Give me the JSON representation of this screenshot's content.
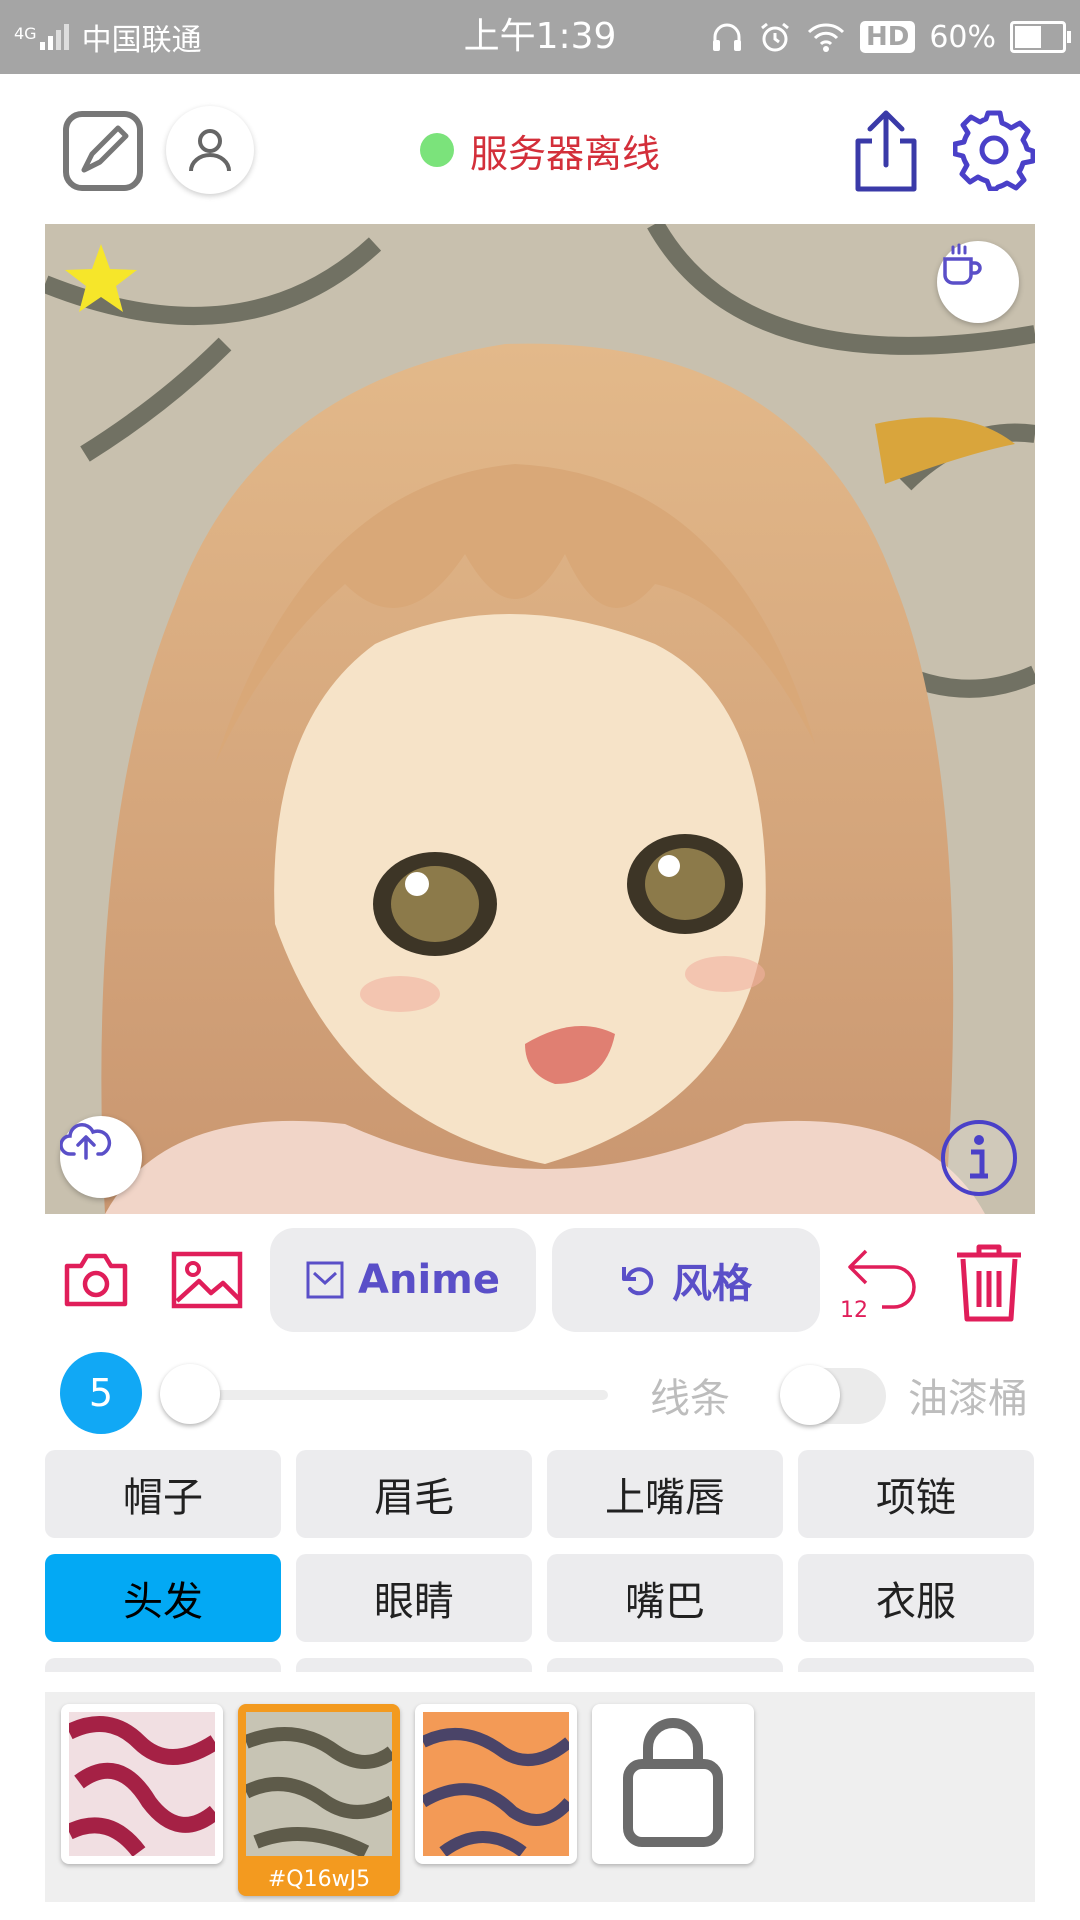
{
  "status_bar": {
    "network": "4G",
    "carrier": "中国联通",
    "time": "上午1:39",
    "hd": "HD",
    "battery": "60%",
    "battery_level": 0.6
  },
  "toolbar": {
    "left_icons": [
      "sketch-icon",
      "user-icon"
    ],
    "server_status": "服务器离线",
    "server_status_color": "#7be37b",
    "right_icons": [
      "share-icon",
      "settings-icon"
    ]
  },
  "canvas": {
    "overlay_icons": [
      "star-icon",
      "coffee-icon",
      "cloud-upload-icon",
      "info-icon"
    ]
  },
  "actions": {
    "camera": "camera-icon",
    "gallery": "image-icon",
    "anime_label": "Anime",
    "style_label": "风格",
    "undo_count": "12",
    "delete": "trash-icon"
  },
  "controls": {
    "brush_size": "5",
    "slider_value": 0,
    "line_label": "线条",
    "bucket_label": "油漆桶",
    "bucket_enabled": false
  },
  "categories": [
    {
      "label": "帽子",
      "selected": false
    },
    {
      "label": "眉毛",
      "selected": false
    },
    {
      "label": "上嘴唇",
      "selected": false
    },
    {
      "label": "项链",
      "selected": false
    },
    {
      "label": "头发",
      "selected": true
    },
    {
      "label": "眼睛",
      "selected": false
    },
    {
      "label": "嘴巴",
      "selected": false
    },
    {
      "label": "衣服",
      "selected": false
    }
  ],
  "swatches": {
    "selected_id": "#Q16wJ5",
    "add_icon": "shopping-bag-icon"
  },
  "colors": {
    "accent_pink": "#e01e5a",
    "accent_purple": "#5a4fc8",
    "selected_blue": "#03a9f4",
    "selected_orange": "#f39a1f",
    "status_red": "#d32f3a"
  }
}
